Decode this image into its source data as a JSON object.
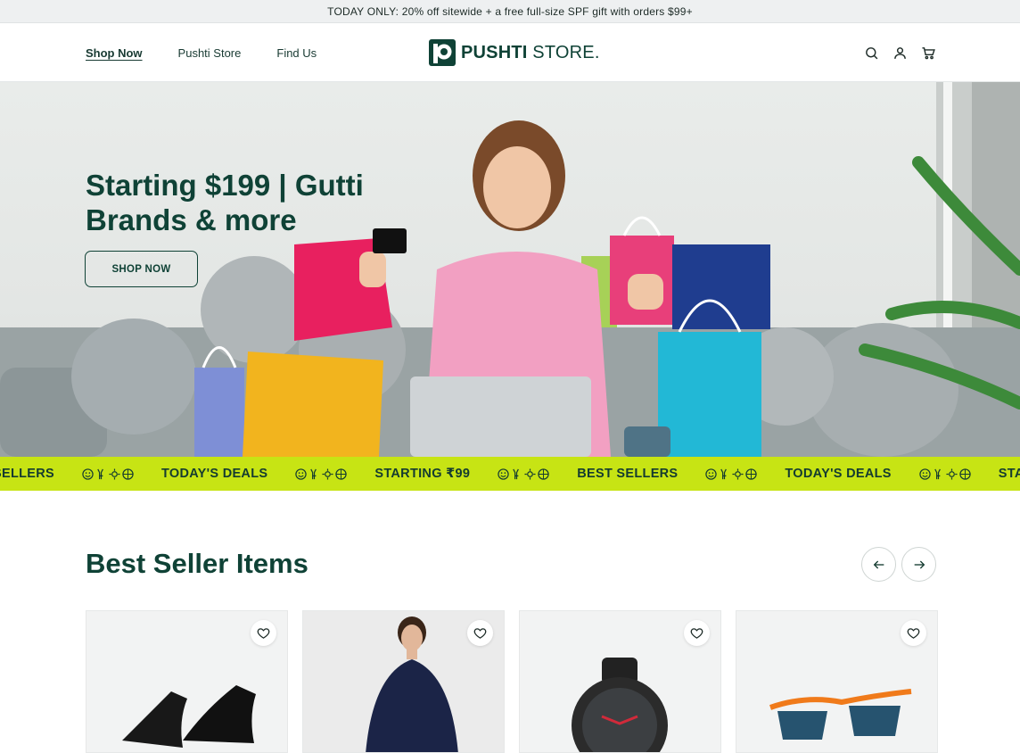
{
  "announcement": "TODAY ONLY: 20% off sitewide + a free full-size SPF gift with orders $99+",
  "nav": [
    {
      "label": "Shop Now"
    },
    {
      "label": "Pushti Store"
    },
    {
      "label": "Find Us"
    }
  ],
  "logo": {
    "bold": "PUSHTI",
    "thin": " STORE."
  },
  "header_icons": [
    "search-icon",
    "user-icon",
    "cart-icon"
  ],
  "hero": {
    "title": "Starting $199 | Gutti Brands & more",
    "cta": "SHOP NOW"
  },
  "marquee": {
    "items": [
      "SELLERS",
      "TODAY'S DEALS",
      "STARTING ₹99",
      "BEST SELLERS",
      "TODAY'S DEALS",
      "STARTIN"
    ]
  },
  "section": {
    "title": "Best Seller Items",
    "prev_icon": "arrow-left-icon",
    "next_icon": "arrow-right-icon"
  },
  "products": [
    {
      "image": "black-sneakers"
    },
    {
      "image": "model-in-navy-sweater"
    },
    {
      "image": "smartwatch"
    },
    {
      "image": "sunglasses"
    }
  ],
  "colors": {
    "brand_green": "#0f4236",
    "marquee_lime": "#c7e414"
  }
}
